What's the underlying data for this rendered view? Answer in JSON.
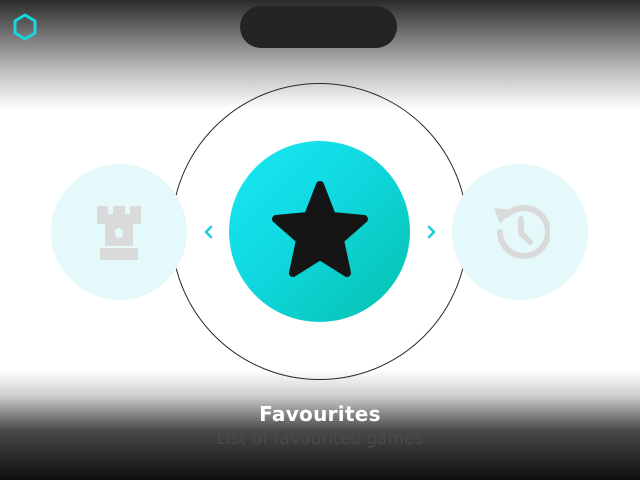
{
  "menu": {
    "selected": {
      "title": "Favourites",
      "description": "List of favourited games",
      "icon": "star-icon"
    },
    "previous": {
      "icon": "chess-rook-icon"
    },
    "next": {
      "icon": "history-icon"
    }
  },
  "icons": {
    "logo": "hexagon-logo-icon",
    "prev_arrow": "chevron-left-icon",
    "next_arrow": "chevron-right-icon"
  },
  "colors": {
    "accent": "#10d8df",
    "accent_dark": "#04c0ac",
    "side_bg": "#e6f9fa",
    "side_icon": "#dadada",
    "pill": "#242424"
  }
}
